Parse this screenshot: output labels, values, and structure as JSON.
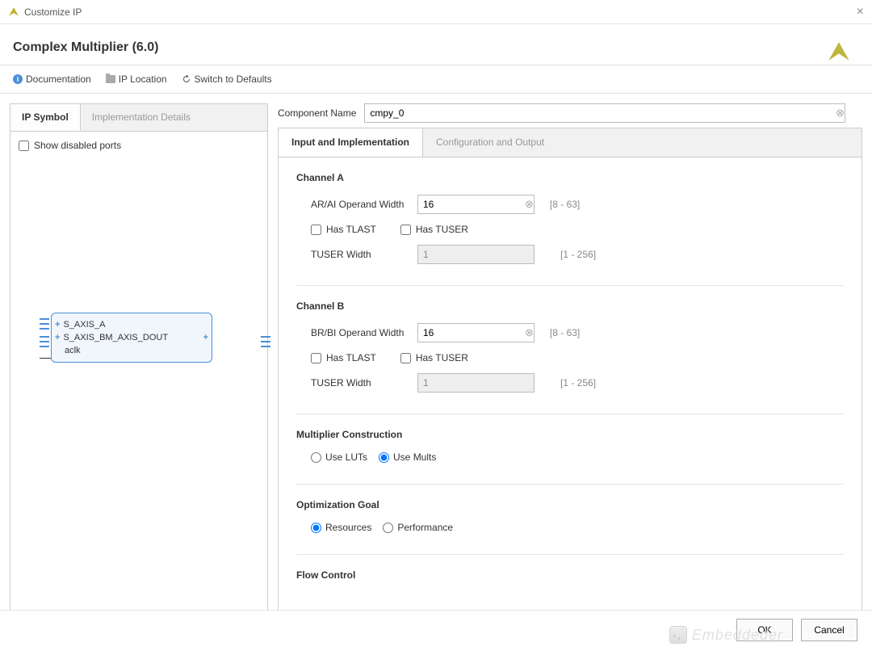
{
  "window": {
    "title": "Customize IP"
  },
  "header": {
    "title": "Complex Multiplier (6.0)"
  },
  "toolbar": {
    "documentation": "Documentation",
    "ip_location": "IP Location",
    "switch_defaults": "Switch to Defaults"
  },
  "left": {
    "tabs": [
      {
        "label": "IP Symbol",
        "active": true
      },
      {
        "label": "Implementation Details",
        "active": false
      }
    ],
    "show_disabled_label": "Show disabled ports",
    "ports": {
      "a": "S_AXIS_A",
      "b": "S_AXIS_BM_AXIS_DOUT",
      "clk": "aclk"
    }
  },
  "component_name": {
    "label": "Component Name",
    "value": "cmpy_0"
  },
  "tabs": [
    {
      "label": "Input and Implementation",
      "active": true
    },
    {
      "label": "Configuration and Output",
      "active": false
    }
  ],
  "channel_a": {
    "title": "Channel A",
    "operand_label": "AR/AI Operand Width",
    "operand_value": "16",
    "operand_range": "[8 - 63]",
    "has_tlast": "Has TLAST",
    "has_tuser": "Has TUSER",
    "tuser_label": "TUSER Width",
    "tuser_value": "1",
    "tuser_range": "[1 - 256]"
  },
  "channel_b": {
    "title": "Channel B",
    "operand_label": "BR/BI Operand Width",
    "operand_value": "16",
    "operand_range": "[8 - 63]",
    "has_tlast": "Has TLAST",
    "has_tuser": "Has TUSER",
    "tuser_label": "TUSER Width",
    "tuser_value": "1",
    "tuser_range": "[1 - 256]"
  },
  "mult_construction": {
    "title": "Multiplier Construction",
    "use_luts": "Use LUTs",
    "use_mults": "Use Mults",
    "selected": "Use Mults"
  },
  "opt_goal": {
    "title": "Optimization Goal",
    "resources": "Resources",
    "performance": "Performance",
    "selected": "Resources"
  },
  "flow_control": {
    "title": "Flow Control"
  },
  "footer": {
    "ok": "OK",
    "cancel": "Cancel"
  },
  "watermark": "Embeddeder"
}
